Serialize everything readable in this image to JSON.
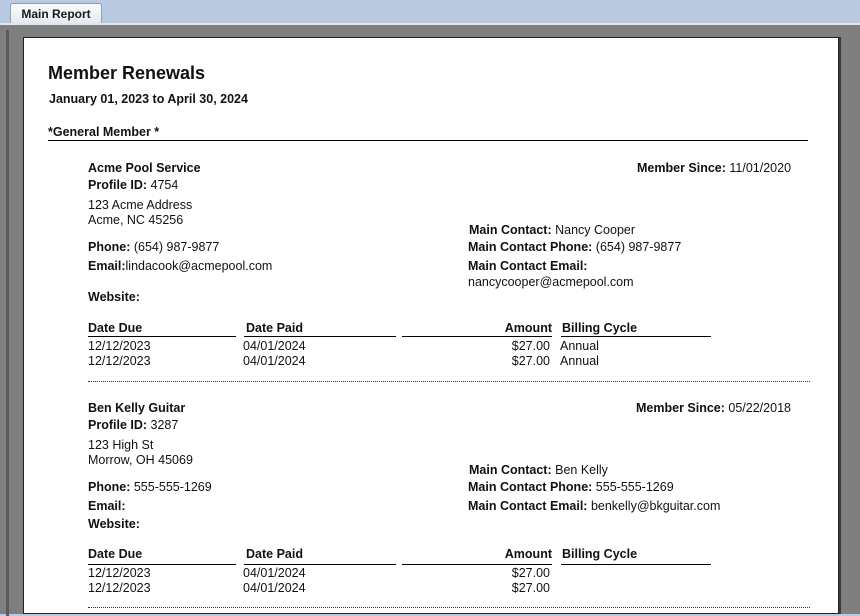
{
  "tab": {
    "label": "Main Report"
  },
  "report": {
    "title": "Member Renewals",
    "date_range": "January 01, 2023 to April 30, 2024",
    "group_label": "*General Member *"
  },
  "labels": {
    "member_since": "Member Since:",
    "profile_id": "Profile ID:",
    "phone": "Phone:",
    "email": "Email:",
    "website": "Website:",
    "main_contact": "Main Contact:",
    "main_contact_phone": "Main Contact Phone:",
    "main_contact_email": "Main Contact Email:",
    "date_due": "Date Due",
    "date_paid": "Date Paid",
    "amount": "Amount",
    "billing_cycle": "Billing Cycle"
  },
  "members": [
    {
      "name": "Acme Pool Service",
      "member_since": "11/01/2020",
      "profile_id": "4754",
      "address1": "123 Acme Address",
      "address2": "Acme, NC 45256",
      "phone": "(654) 987-9877",
      "email": "lindacook@acmepool.com",
      "website": "",
      "main_contact": "Nancy Cooper",
      "main_contact_phone": "(654) 987-9877",
      "main_contact_email": "nancycooper@acmepool.com",
      "payments": [
        {
          "date_due": "12/12/2023",
          "date_paid": "04/01/2024",
          "amount": "$27.00",
          "billing_cycle": "Annual"
        },
        {
          "date_due": "12/12/2023",
          "date_paid": "04/01/2024",
          "amount": "$27.00",
          "billing_cycle": "Annual"
        }
      ]
    },
    {
      "name": "Ben Kelly Guitar",
      "member_since": "05/22/2018",
      "profile_id": "3287",
      "address1": "123 High St",
      "address2": "Morrow, OH 45069",
      "phone": "555-555-1269",
      "email": "",
      "website": "",
      "main_contact": "Ben Kelly",
      "main_contact_phone": "555-555-1269",
      "main_contact_email": "benkelly@bkguitar.com",
      "payments": [
        {
          "date_due": "12/12/2023",
          "date_paid": "04/01/2024",
          "amount": "$27.00",
          "billing_cycle": ""
        },
        {
          "date_due": "12/12/2023",
          "date_paid": "04/01/2024",
          "amount": "$27.00",
          "billing_cycle": ""
        }
      ]
    }
  ]
}
